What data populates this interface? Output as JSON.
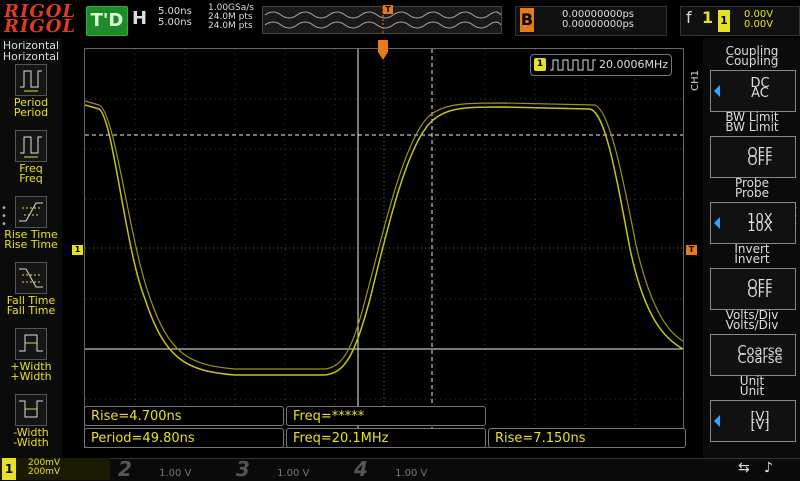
{
  "brand": "RIGOL",
  "topbar": {
    "run_state": "T'D",
    "h_icon": "H",
    "timebase_main": "5.00ns",
    "timebase_delayed": "5.00ns",
    "sample_rate": "1.00GSa/s",
    "memory_depth_1": "24.0M pts",
    "memory_depth_2": "24.0M pts",
    "trigger_pos_marker": "T",
    "trigger_time_1": "0.00000000ps",
    "trigger_time_2": "0.00000000ps",
    "trigger_icon": "B",
    "trigger_slope": "f",
    "trigger_source": "1",
    "trigger_level_1": "0.00V",
    "trigger_level_2": "0.00V"
  },
  "left_panel": {
    "header_1": "Horizontal",
    "header_2": "Horizontal",
    "buttons": [
      {
        "label_1": "Period",
        "label_2": "Period",
        "icon": "period-icon"
      },
      {
        "label_1": "Freq",
        "label_2": "Freq",
        "icon": "freq-icon"
      },
      {
        "label_1": "Rise Time",
        "label_2": "Rise Time",
        "icon": "rise-time-icon"
      },
      {
        "label_1": "Fall Time",
        "label_2": "Fall Time",
        "icon": "fall-time-icon"
      },
      {
        "label_1": "+Width",
        "label_2": "+Width",
        "icon": "pos-width-icon"
      },
      {
        "label_1": "-Width",
        "label_2": "-Width",
        "icon": "neg-width-icon"
      }
    ]
  },
  "screen": {
    "ch1_marker": "1",
    "trigger_marker": "T",
    "ch1_vertical_label": "CH1",
    "counter_channel": "1",
    "counter_value": "20.0006MHz"
  },
  "measurements": {
    "row1_rise": "Rise=4.700ns",
    "row1_freq": "Freq=*****",
    "row2_period": "Period=49.80ns",
    "row2_freq": "Freq=20.1MHz",
    "row2_rise": "Rise=7.150ns"
  },
  "right_menu": {
    "coupling_title": "Coupling",
    "coupling_values": [
      "DC",
      "AC"
    ],
    "bwlimit_title": "BW Limit",
    "bwlimit_value": "OFF",
    "probe_title": "Probe",
    "probe_value": "10X",
    "invert_title": "Invert",
    "invert_value": "OFF",
    "voltsdiv_title": "Volts/Div",
    "voltsdiv_value": "Coarse",
    "unit_title": "Unit",
    "unit_value": "[V]"
  },
  "bottombar": {
    "ch1": {
      "num": "1",
      "scale_1": "200mV",
      "scale_2": "200mV"
    },
    "ch2": {
      "num": "2",
      "scale": "1.00 V"
    },
    "ch3": {
      "num": "3",
      "scale": "1.00 V"
    },
    "ch4": {
      "num": "4",
      "scale": "1.00 V"
    }
  },
  "colors": {
    "ch1": "#e8e023",
    "trigger": "#e87a1a",
    "run_green": "#1f8a2a",
    "accent_blue": "#2aa7ff"
  }
}
